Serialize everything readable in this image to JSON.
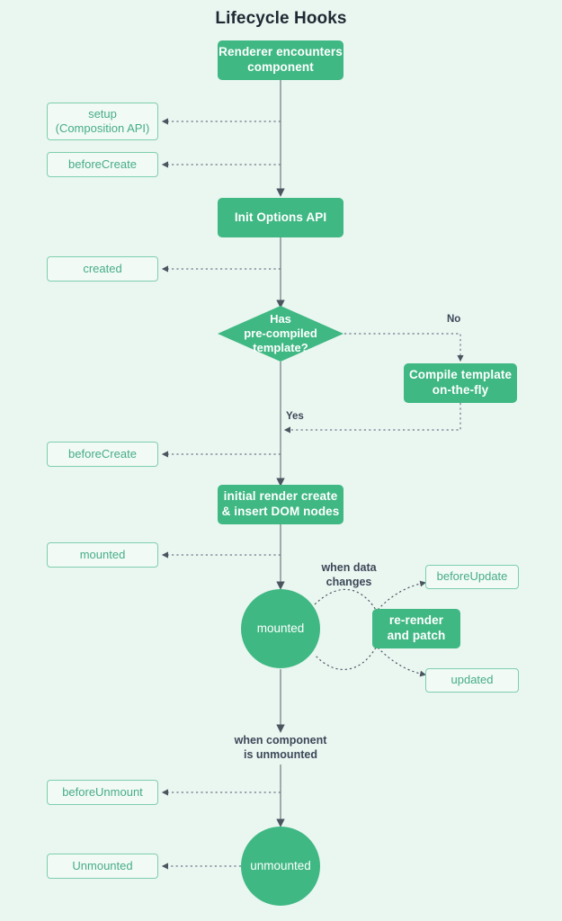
{
  "title": "Lifecycle Hooks",
  "colors": {
    "background": "#eaf6f0",
    "accent_green": "#3fb883",
    "hook_border": "#7ecfae",
    "hook_text": "#46ad86",
    "hook_fill": "#f2faf6",
    "connector": "#8a9a9a",
    "annotation_text": "#3c4858",
    "title_text": "#1f2933"
  },
  "nodes": {
    "renderer": {
      "label": "Renderer encounters\ncomponent",
      "line1": "Renderer encounters",
      "line2": "component",
      "type": "process"
    },
    "setup": {
      "line1": "setup",
      "line2": "(Composition API)",
      "type": "hook"
    },
    "before_create_1": {
      "label": "beforeCreate",
      "type": "hook"
    },
    "init_options": {
      "label": "Init Options API",
      "type": "process"
    },
    "created": {
      "label": "created",
      "type": "hook"
    },
    "decision": {
      "line1": "Has",
      "line2": "pre-compiled",
      "line3": "template?",
      "type": "decision"
    },
    "compile": {
      "line1": "Compile template",
      "line2": "on-the-fly",
      "type": "process"
    },
    "before_create_2": {
      "label": "beforeCreate",
      "type": "hook"
    },
    "initial_render": {
      "line1": "initial render create",
      "line2": "& insert DOM nodes",
      "type": "process"
    },
    "mounted_hook": {
      "label": "mounted",
      "type": "hook"
    },
    "mounted_circle": {
      "label": "mounted",
      "type": "circle"
    },
    "rerender": {
      "line1": "re-render",
      "line2": "and patch",
      "type": "process"
    },
    "before_update": {
      "label": "beforeUpdate",
      "type": "hook"
    },
    "updated": {
      "label": "updated",
      "type": "hook"
    },
    "before_unmount": {
      "label": "beforeUnmount",
      "type": "hook"
    },
    "unmounted_hook": {
      "label": "Unmounted",
      "type": "hook"
    },
    "unmounted_circle": {
      "label": "unmounted",
      "type": "circle"
    }
  },
  "annotations": {
    "when_data_changes_line1": "when data",
    "when_data_changes_line2": "changes",
    "when_unmounted_line1": "when component",
    "when_unmounted_line2": "is unmounted"
  },
  "edge_labels": {
    "no": "No",
    "yes": "Yes"
  }
}
